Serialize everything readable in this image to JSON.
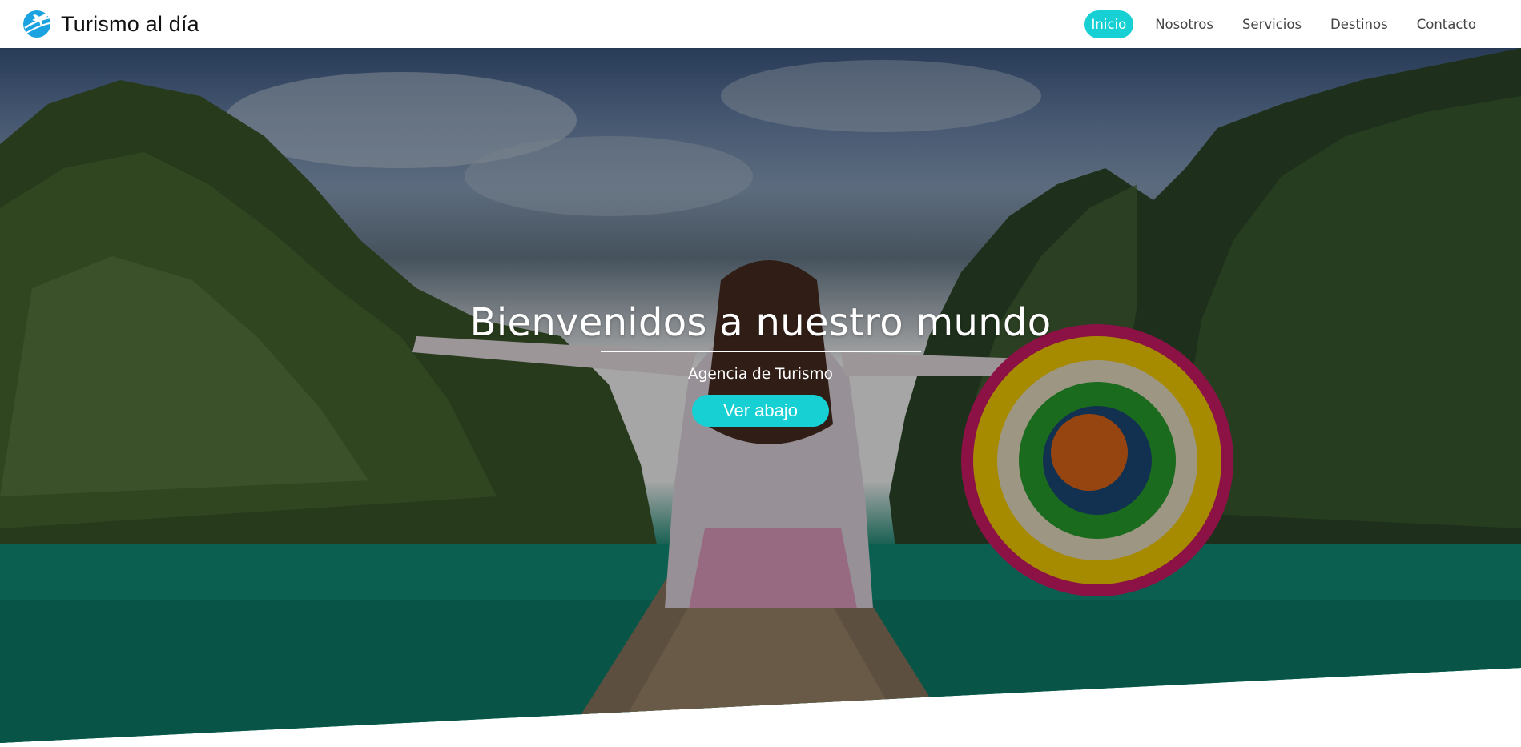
{
  "header": {
    "brand_name": "Turismo al día",
    "logo_icon": "plane-globe-icon",
    "nav": [
      {
        "label": "Inicio",
        "active": true
      },
      {
        "label": "Nosotros",
        "active": false
      },
      {
        "label": "Servicios",
        "active": false
      },
      {
        "label": "Destinos",
        "active": false
      },
      {
        "label": "Contacto",
        "active": false
      }
    ]
  },
  "hero": {
    "title": "Bienvenidos a nuestro mundo",
    "subtitle": "Agencia de Turismo",
    "button_label": "Ver abajo",
    "image_description_icon": "woman-on-boat-photo"
  },
  "colors": {
    "accent": "#17d0d4",
    "nav_text": "#444444",
    "brand_text": "#111111",
    "overlay": "rgba(0,0,0,0.35)"
  }
}
